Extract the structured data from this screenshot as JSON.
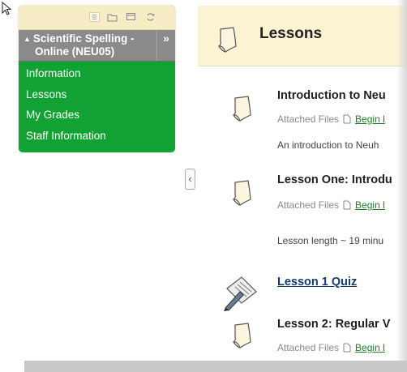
{
  "course_menu": {
    "title_line1": "Scientific Spelling -",
    "title_line2": "Online (NEU05)",
    "expand_glyph": "»",
    "links": [
      "Information",
      "Lessons",
      "My Grades",
      "Staff Information"
    ],
    "accent_color": "#11a233"
  },
  "content": {
    "page_title": "Lessons",
    "items": [
      {
        "title": "Introduction to Neu",
        "attached_label": "Attached Files",
        "file_link": "Begin l",
        "description": "An introduction to Neuh"
      },
      {
        "title": "Lesson One: Introdu",
        "attached_label": "Attached Files",
        "file_link": "Begin l",
        "description": "Lesson length ~ 19 minu"
      },
      {
        "title": "Lesson 1 Quiz"
      },
      {
        "title": "Lesson 2: Regular V",
        "attached_label": "Attached Files",
        "file_link": "Begin l"
      }
    ]
  },
  "icons": {
    "cursor": "mouse-cursor-icon",
    "document": "document-icon",
    "quiz": "quiz-pencil-icon",
    "collapse": "collapse-left-icon"
  }
}
